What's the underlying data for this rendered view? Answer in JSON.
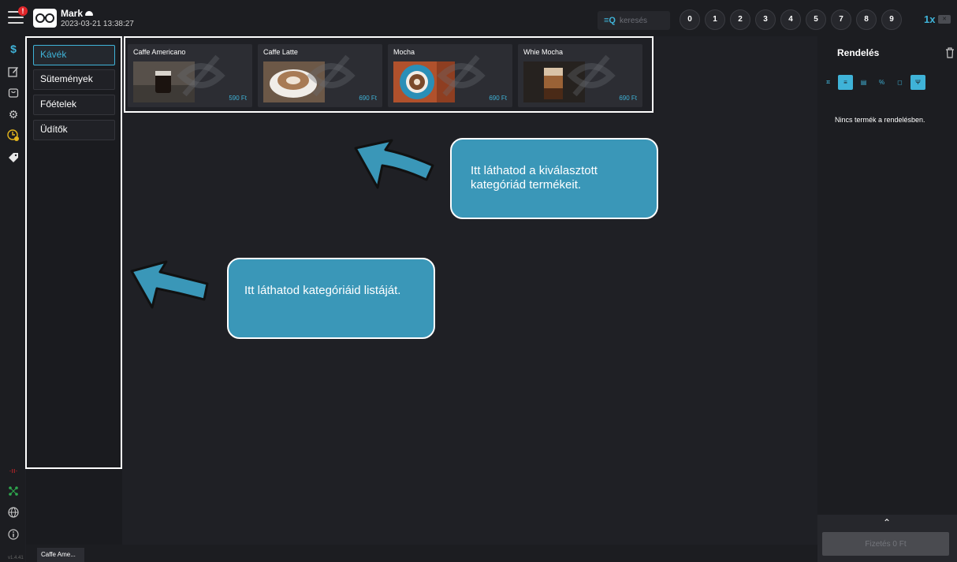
{
  "header": {
    "user_name": "Mark",
    "datetime": "2023-03-21  13:38:27",
    "notification_count": "!",
    "search_placeholder": "keresés",
    "numpad": [
      "0",
      "1",
      "2",
      "3",
      "4",
      "5",
      "7",
      "8",
      "9"
    ],
    "multiplier": "1x"
  },
  "sidebar": {
    "icons": [
      "dollar-icon",
      "edit-icon",
      "bag-icon",
      "gear-icon",
      "clock-icon",
      "tag-icon",
      "signal-icon",
      "network-icon",
      "globe-icon",
      "info-icon"
    ]
  },
  "categories": {
    "items": [
      {
        "label": "Kávék",
        "active": true
      },
      {
        "label": "Sütemények",
        "active": false
      },
      {
        "label": "Főételek",
        "active": false
      },
      {
        "label": "Üdítők",
        "active": false
      }
    ]
  },
  "products": [
    {
      "name": "Caffe Americano",
      "price": "590 Ft"
    },
    {
      "name": "Caffe Latte",
      "price": "690 Ft"
    },
    {
      "name": "Mocha",
      "price": "690 Ft"
    },
    {
      "name": "Whie Mocha",
      "price": "690 Ft"
    }
  ],
  "callouts": {
    "products_hint": "Itt láthatod a kiválasztott kategóriád termékeit.",
    "categories_hint": "Itt láthatod kategóriáid listáját."
  },
  "order": {
    "title": "Rendelés",
    "empty_message": "Nincs termék a rendelésben.",
    "pay_label": "Fizetés 0 Ft"
  },
  "bottom": {
    "open_tab": "Caffe Ame...",
    "version": "v1.4.41"
  },
  "colors": {
    "accent": "#3fb3d8",
    "callout": "#3a97b8",
    "background": "#1f2025"
  }
}
